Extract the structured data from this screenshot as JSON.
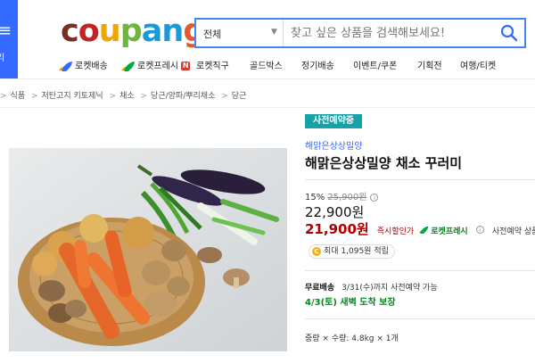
{
  "header": {
    "category_menu_label": "리",
    "logo": {
      "letters": [
        "c",
        "o",
        "u",
        "p",
        "a",
        "n",
        "g"
      ],
      "colors": [
        "#7a2e1f",
        "#c52323",
        "#f0a500",
        "#6eb43f",
        "#1a9bd7",
        "#1a9bd7",
        "#e45a2a"
      ]
    },
    "search": {
      "category": "전체",
      "placeholder": "찾고 싶은 상품을 검색해보세요!"
    },
    "nav": [
      {
        "label": "로켓배송",
        "icon": "rocket-icon"
      },
      {
        "label": "로켓프레시",
        "icon": "rocket-fresh-icon",
        "badge": "N"
      },
      {
        "label": "로켓직구"
      },
      {
        "label": "골드박스"
      },
      {
        "label": "정기배송"
      },
      {
        "label": "이벤트/쿠폰"
      },
      {
        "label": "기획전"
      },
      {
        "label": "여행/티켓"
      }
    ]
  },
  "breadcrumb": [
    "식품",
    "저탄고지 키토제닉",
    "채소",
    "당근/양파/뿌리채소",
    "당근"
  ],
  "product": {
    "badge": "사전예약중",
    "brand": "해맑은상상밀양",
    "title": "해맑은상상밀양 채소 꾸러미",
    "discount_rate": "15%",
    "original_price": "25,900원",
    "price": "22,900원",
    "sale_price": "21,900원",
    "instant_discount_label": "즉시할인가",
    "rocket_fresh_label": "로켓프레시",
    "prebuy_label": "사전예약 상품",
    "points": "최대 1,095원 적립",
    "shipping_label": "무료배송",
    "shipping_detail": "3/31(수)까지 사전예약 가능",
    "arrival": "4/3(토) 새벽 도착 보장",
    "options": "중량 × 수량: 4.8kg × 1개"
  },
  "colors": {
    "brand_blue": "#346aff",
    "search_border": "#4285f4",
    "badge_teal": "#17a2a8",
    "sale_red": "#ae0000",
    "fresh_green": "#00891a"
  }
}
